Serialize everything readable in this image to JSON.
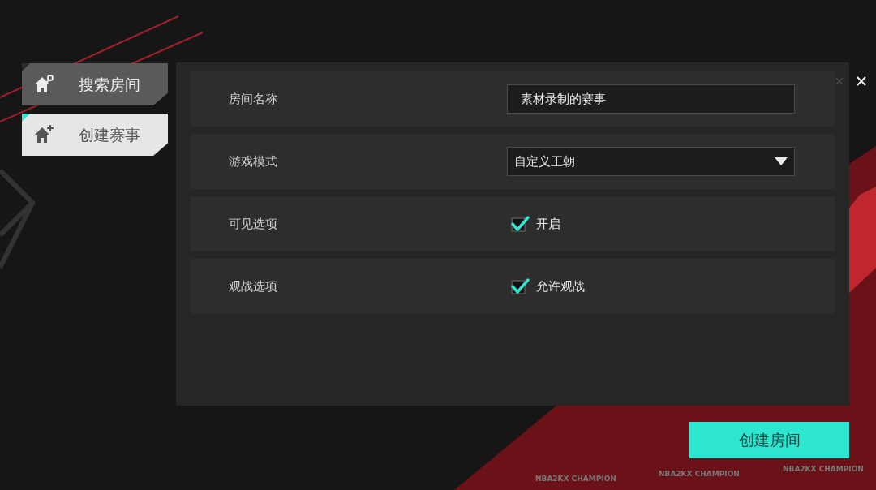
{
  "sidebar": {
    "tabs": [
      {
        "label": "搜索房间",
        "selected": false
      },
      {
        "label": "创建赛事",
        "selected": true
      }
    ]
  },
  "form": {
    "rows": [
      {
        "kind": "text",
        "label": "房间名称",
        "value": "素材录制的赛事"
      },
      {
        "kind": "dropdown",
        "label": "游戏模式",
        "value": "自定义王朝"
      },
      {
        "kind": "checkbox",
        "label": "可见选项",
        "option": "开启",
        "checked": true
      },
      {
        "kind": "checkbox",
        "label": "观战选项",
        "option": "允许观战",
        "checked": true
      }
    ]
  },
  "primary_button": "创建房间",
  "background_banner": [
    "NBA2KX CHAMPION",
    "NBA2KX CHAMPION",
    "NBA2KX CHAMPION"
  ]
}
